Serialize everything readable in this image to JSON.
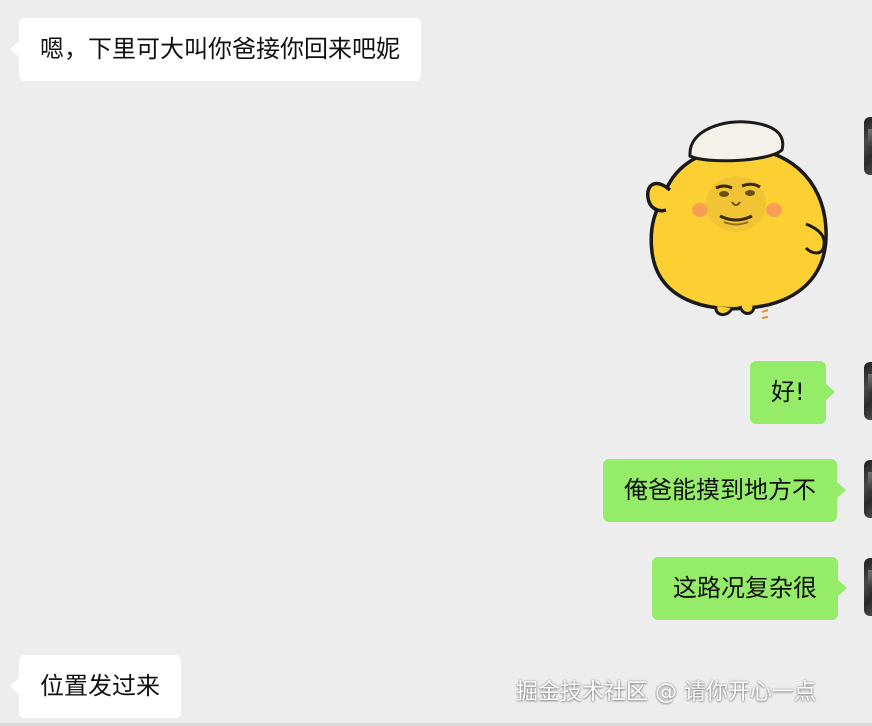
{
  "messages": [
    {
      "side": "incoming",
      "type": "text",
      "text": "嗯，下里可大叫你爸接你回来吧妮"
    },
    {
      "side": "outgoing",
      "type": "sticker",
      "sticker": "yellow-chick-meme-face"
    },
    {
      "side": "outgoing",
      "type": "text",
      "text": "好!"
    },
    {
      "side": "outgoing",
      "type": "text",
      "text": "俺爸能摸到地方不"
    },
    {
      "side": "outgoing",
      "type": "text",
      "text": "这路况复杂很"
    },
    {
      "side": "incoming",
      "type": "text",
      "text": "位置发过来"
    }
  ],
  "watermark": "掘金技术社区 @ 请你开心一点",
  "colors": {
    "background": "#ededed",
    "incoming_bubble": "#ffffff",
    "outgoing_bubble": "#95ec69",
    "sticker_body": "#fcd032"
  }
}
